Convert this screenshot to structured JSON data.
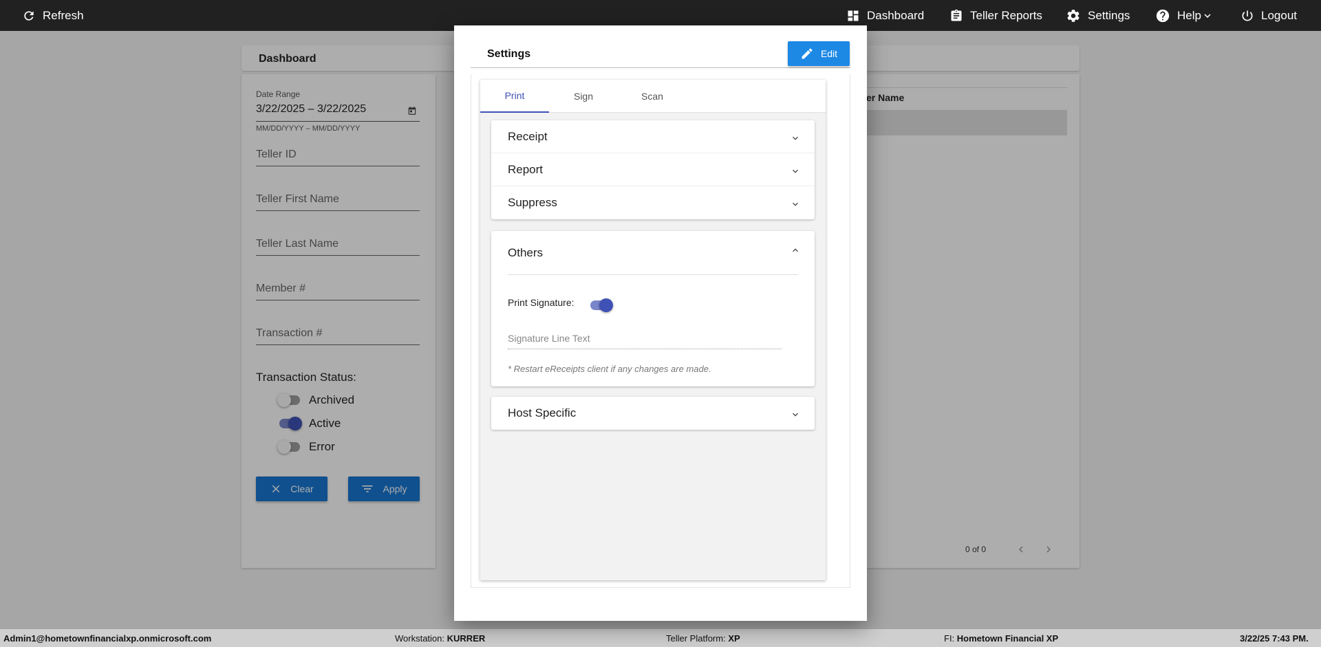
{
  "nav": {
    "refresh": "Refresh",
    "dashboard": "Dashboard",
    "teller_reports": "Teller Reports",
    "settings": "Settings",
    "help": "Help",
    "logout": "Logout"
  },
  "dashboard": {
    "title": "Dashboard",
    "date_range_label": "Date Range",
    "date_range_value": "3/22/2025 – 3/22/2025",
    "date_format_hint": "MM/DD/YYYY – MM/DD/YYYY",
    "fields": {
      "teller_id": "Teller ID",
      "teller_first_name": "Teller First Name",
      "teller_last_name": "Teller Last Name",
      "member": "Member #",
      "transaction": "Transaction #"
    },
    "status_label": "Transaction Status:",
    "statuses": [
      {
        "label": "Archived",
        "on": false
      },
      {
        "label": "Active",
        "on": true
      },
      {
        "label": "Error",
        "on": false
      }
    ],
    "clear": "Clear",
    "apply": "Apply",
    "results_column": "er Name",
    "pagination": "0 of 0"
  },
  "modal": {
    "title": "Settings",
    "edit": "Edit",
    "tabs": [
      "Print",
      "Sign",
      "Scan"
    ],
    "active_tab": "Print",
    "accordion": [
      "Receipt",
      "Report",
      "Suppress"
    ],
    "others": {
      "title": "Others",
      "print_signature_label": "Print Signature:",
      "print_signature_on": true,
      "signature_placeholder": "Signature Line Text",
      "note": "* Restart eReceipts client if any changes are made."
    },
    "host_specific": "Host Specific"
  },
  "footer": {
    "user": "Admin1@hometownfinancialxp.onmicrosoft.com",
    "workstation_label": "Workstation:",
    "workstation": "KURRER",
    "platform_label": "Teller Platform:",
    "platform": "XP",
    "fi_label": "FI:",
    "fi": "Hometown Financial XP",
    "datetime": "3/22/25 7:43 PM."
  }
}
